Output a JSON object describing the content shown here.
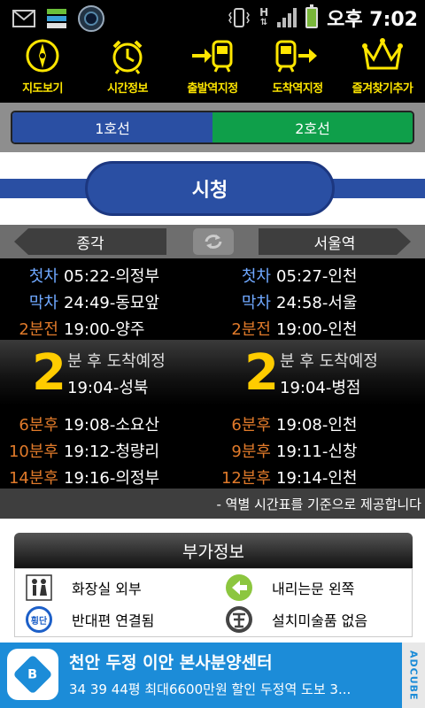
{
  "status_bar": {
    "time": "오후 7:02",
    "icons": [
      "mail-icon",
      "grid-app-icon",
      "camera-icon",
      "vibrate-icon",
      "hsdpa-icon",
      "signal-icon",
      "battery-icon"
    ],
    "network_label": "H"
  },
  "toolbar": {
    "items": [
      {
        "label": "지도보기",
        "icon": "compass-icon"
      },
      {
        "label": "시간정보",
        "icon": "alarm-clock-icon"
      },
      {
        "label": "출발역지정",
        "icon": "departure-train-icon"
      },
      {
        "label": "도착역지정",
        "icon": "arrival-train-icon"
      },
      {
        "label": "즐겨찾기추가",
        "icon": "crown-icon"
      }
    ],
    "color": "#ffe600"
  },
  "line_tabs": {
    "line1": "1호선",
    "line2": "2호선",
    "line1_color": "#2a4fa3",
    "line2_color": "#0f9f4a"
  },
  "station": {
    "name": "시청"
  },
  "directions": {
    "left": "종각",
    "right": "서울역"
  },
  "schedule": {
    "left": [
      {
        "label": "첫차",
        "value": "05:22-의정부"
      },
      {
        "label": "막차",
        "value": "24:49-동묘앞"
      },
      {
        "label": "2분전",
        "value": "19:00-양주"
      }
    ],
    "right": [
      {
        "label": "첫차",
        "value": "05:27-인천"
      },
      {
        "label": "막차",
        "value": "24:58-서울"
      },
      {
        "label": "2분전",
        "value": "19:00-인천"
      }
    ]
  },
  "arrival": {
    "left": {
      "minutes": "2",
      "message": "분 후 도착예정",
      "time": "19:04-성북"
    },
    "right": {
      "minutes": "2",
      "message": "분 후 도착예정",
      "time": "19:04-병점"
    }
  },
  "next_trains": {
    "left": [
      {
        "label": "6분후",
        "value": "19:08-소요산"
      },
      {
        "label": "10분후",
        "value": "19:12-청량리"
      },
      {
        "label": "14분후",
        "value": "19:16-의정부"
      }
    ],
    "right": [
      {
        "label": "6분후",
        "value": "19:08-인천"
      },
      {
        "label": "9분후",
        "value": "19:11-신창"
      },
      {
        "label": "12분후",
        "value": "19:14-인천"
      }
    ]
  },
  "notice": "- 역별 시간표를 기준으로 제공합니다",
  "extra_info": {
    "title": "부가정보",
    "items": [
      {
        "icon": "restroom-icon",
        "text": "화장실 외부"
      },
      {
        "icon": "left-arrow-icon",
        "text": "내리는문 왼쪽"
      },
      {
        "icon": "crossing-icon",
        "text": "반대편 연결됨",
        "icon_text": "횡단"
      },
      {
        "icon": "facility-icon",
        "text": "설치미술품 없음"
      }
    ]
  },
  "ad": {
    "title": "천안 두정 이안 본사분양센터",
    "subtitle": "34 39 44평 최대6600만원 할인 두정역 도보 3...",
    "side_label": "ADCUBE",
    "logo_text": "B"
  }
}
